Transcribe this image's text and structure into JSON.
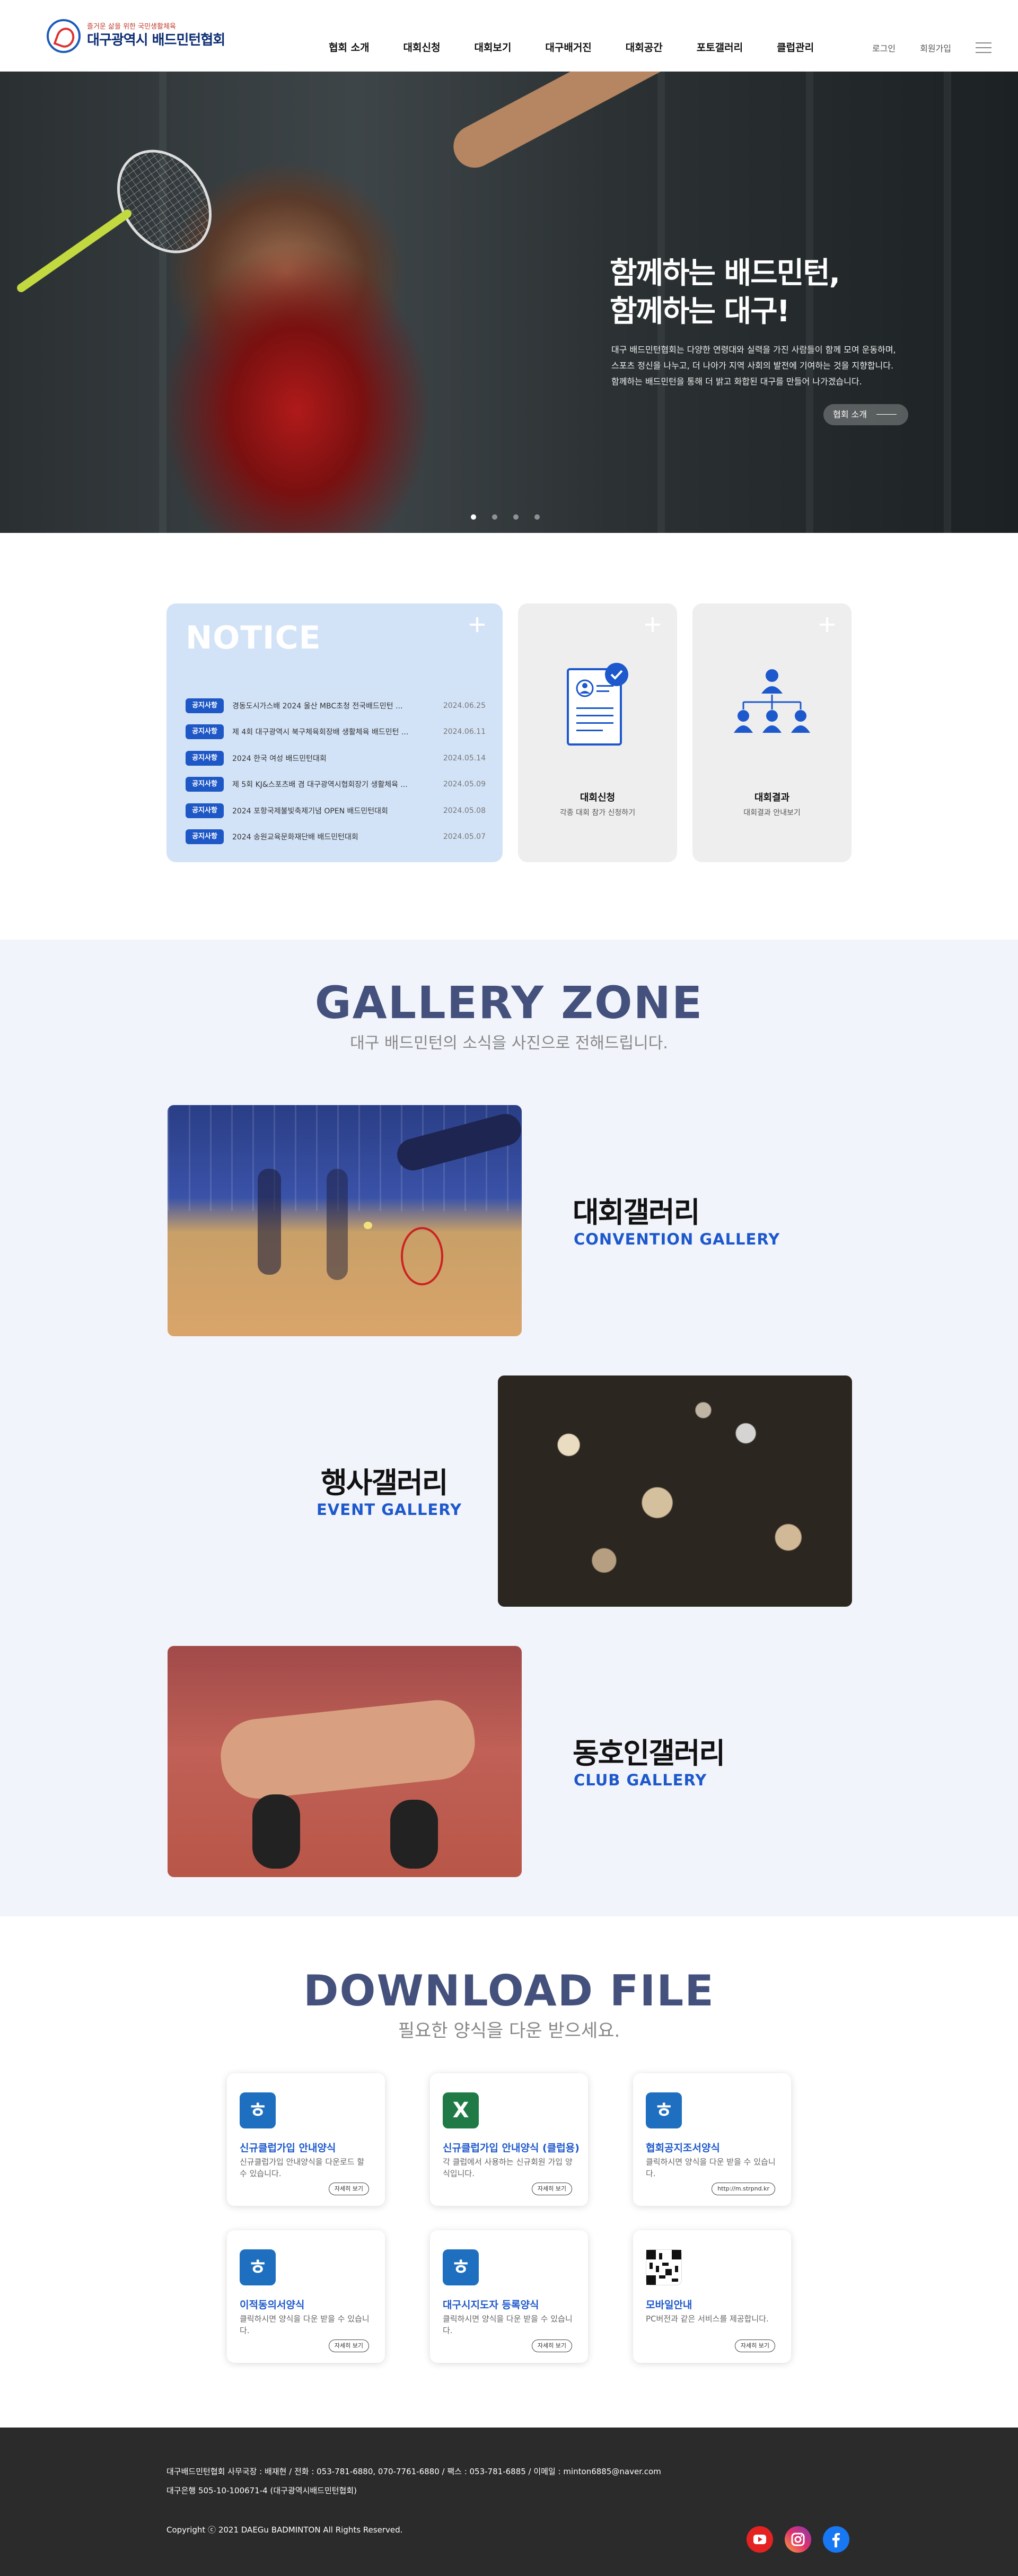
{
  "header": {
    "logo_sub": "즐거운 삶을 위한 국민생활체육",
    "logo_main": "대구광역시 배드민턴협회",
    "nav": [
      "협회 소개",
      "대회신청",
      "대회보기",
      "대구배거진",
      "대회공간",
      "포토갤러리",
      "클럽관리"
    ],
    "login": "로그인",
    "join": "회원가입"
  },
  "hero": {
    "title_line1": "함께하는 배드민턴,",
    "title_line2": "함께하는 대구!",
    "desc_line1": "대구 배드민턴협회는 다양한 연령대와 실력을 가진 사람들이 함께 모여 운동하며,",
    "desc_line2": "스포츠 정신을 나누고, 더 나아가 지역 사회의 발전에 기여하는 것을 지향합니다.",
    "desc_line3": "함께하는 배드민턴을 통해 더 밝고 화합된 대구를 만들어 나가겠습니다.",
    "button": "협회 소개",
    "slides_total": 4,
    "slide_active": 1
  },
  "notice": {
    "title": "NOTICE",
    "items": [
      {
        "badge": "공지사항",
        "text": "경동도시가스배 2024 울산 MBC초청 전국배드민턴 ...",
        "date": "2024.06.25"
      },
      {
        "badge": "공지사항",
        "text": "제 4회 대구광역시 북구체육회장배 생활체육 배드민턴 ...",
        "date": "2024.06.11"
      },
      {
        "badge": "공지사항",
        "text": "2024 한국 여성 배드민턴대회",
        "date": "2024.05.14"
      },
      {
        "badge": "공지사항",
        "text": "제 5회 KJ&스포츠배 겸 대구광역시협회장기 생활체육 ...",
        "date": "2024.05.09"
      },
      {
        "badge": "공지사항",
        "text": "2024 포항국제불빛축제기념 OPEN 배드민턴대회",
        "date": "2024.05.08"
      },
      {
        "badge": "공지사항",
        "text": "2024 송원교육문화재단배 배드민턴대회",
        "date": "2024.05.07"
      }
    ]
  },
  "cards": [
    {
      "name": "대회신청",
      "sub": "각종 대회 참가 신청하기",
      "icon": "application-form-icon"
    },
    {
      "name": "대회결과",
      "sub": "대회결과 안내보기",
      "icon": "org-chart-icon"
    }
  ],
  "gallery": {
    "title": "GALLERY ZONE",
    "subtitle": "대구 배드민턴의 소식을 사진으로 전해드립니다.",
    "items": [
      {
        "kr": "대회갤러리",
        "en": "CONVENTION GALLERY"
      },
      {
        "kr": "행사갤러리",
        "en": "EVENT GALLERY"
      },
      {
        "kr": "동호인갤러리",
        "en": "CLUB GALLERY"
      }
    ]
  },
  "download": {
    "title": "DOWNLOAD FILE",
    "subtitle": "필요한 양식을 다운 받으세요.",
    "items": [
      {
        "name": "신규클럽가입 안내양식",
        "desc": "신규클럽가입 안내양식을 다운로드 할 수 있습니다.",
        "btn": "자세히 보기",
        "icon": "hwp-icon",
        "color": "#1e6fc0"
      },
      {
        "name": "신규클럽가입 안내양식 (클럽용)",
        "desc": "각 클럽에서 사용하는 신규회원 가입 양식입니다.",
        "btn": "자세히 보기",
        "icon": "excel-icon",
        "color": "#1f7a45"
      },
      {
        "name": "협회공지조서양식",
        "desc": "클릭하시면 양식을 다운 받을 수 있습니다.",
        "btn": "http://m.strpnd.kr",
        "icon": "hwp-icon",
        "color": "#1e6fc0"
      },
      {
        "name": "이적동의서양식",
        "desc": "클릭하시면 양식을 다운 받을 수 있습니다.",
        "btn": "자세히 보기",
        "icon": "hwp-icon",
        "color": "#1e6fc0"
      },
      {
        "name": "대구시지도자 등록양식",
        "desc": "클릭하시면 양식을 다운 받을 수 있습니다.",
        "btn": "자세히 보기",
        "icon": "hwp-icon",
        "color": "#1e6fc0"
      },
      {
        "name": "모바일안내",
        "desc": "PC버전과 같은 서비스를 제공합니다.",
        "btn": "자세히 보기",
        "icon": "qr-code-icon",
        "color": "#ffffff"
      }
    ]
  },
  "footer": {
    "line1": "대구배드민턴협회 사무국장 : 배재현 / 전화 : 053-781-6880, 070-7761-6880 / 팩스 : 053-781-6885 / 이메일 : minton6885@naver.com",
    "line2": "대구은행 505-10-100671-4 (대구광역시배드민턴협회)",
    "copyright": "Copyright ⓒ 2021 DAEGu BADMINTON All Rights Reserved.",
    "sns": [
      "youtube-icon",
      "instagram-icon",
      "facebook-icon"
    ]
  }
}
